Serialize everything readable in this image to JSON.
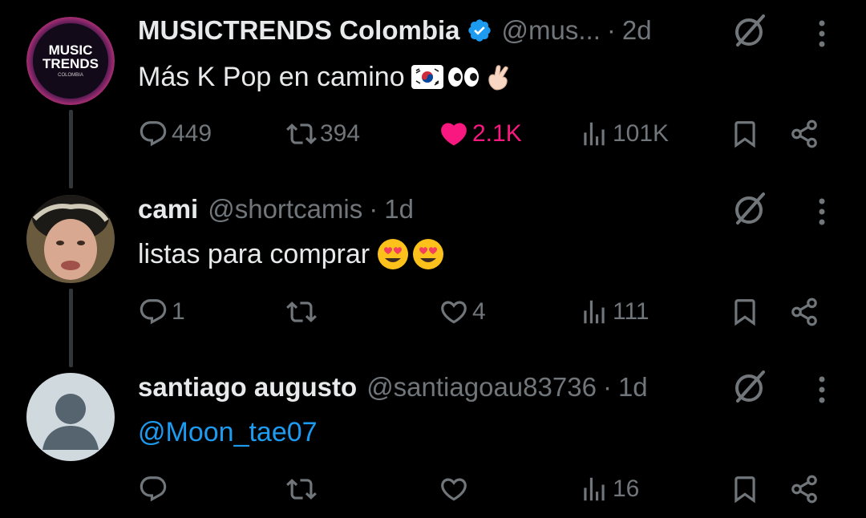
{
  "tweets": [
    {
      "display_name": "MUSICTRENDS Colombia",
      "verified": true,
      "handle": "@mus...",
      "separator": "·",
      "time": "2d",
      "text": "Más K Pop en camino",
      "text_emojis": [
        "korea-flag",
        "eyes",
        "pinching-hand"
      ],
      "avatar_text": {
        "line1": "MUSIC",
        "line2": "TRENDS",
        "line3": "COLOMBIA"
      },
      "stats": {
        "replies": "449",
        "reposts": "394",
        "likes": "2.1K",
        "views": "101K"
      },
      "liked": true
    },
    {
      "display_name": "cami",
      "handle": "@shortcamis",
      "separator": "·",
      "time": "1d",
      "text": "listas para comprar",
      "text_emojis": [
        "heart-eyes",
        "heart-eyes"
      ],
      "stats": {
        "replies": "1",
        "reposts": "",
        "likes": "4",
        "views": "111"
      },
      "liked": false
    },
    {
      "display_name": "santiago augusto",
      "handle": "@santiagoau83736",
      "separator": "·",
      "time": "1d",
      "text": "@Moon_tae07",
      "stats": {
        "replies": "",
        "reposts": "",
        "likes": "",
        "views": "16"
      },
      "liked": false
    }
  ],
  "colors": {
    "background": "#000000",
    "text": "#e7e9ea",
    "muted": "#71767b",
    "like": "#f91880",
    "link": "#1d9bf0",
    "verified": "#1d9bf0",
    "thread_line": "#333639"
  },
  "icons": [
    "reply-icon",
    "repost-icon",
    "like-icon",
    "views-icon",
    "bookmark-icon",
    "share-icon",
    "grok-icon",
    "more-icon",
    "verified-icon"
  ]
}
